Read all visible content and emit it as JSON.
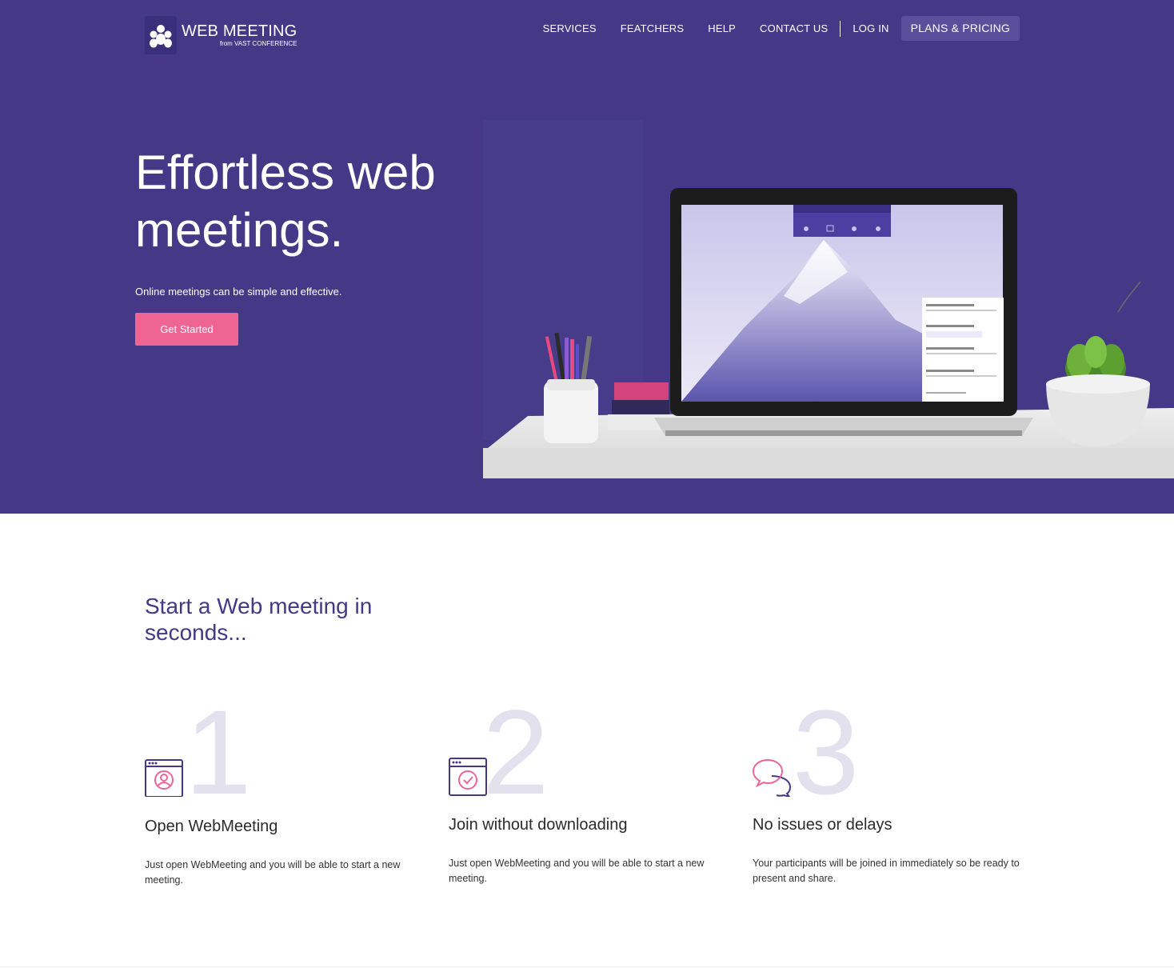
{
  "brand": {
    "title": "WEB MEETING",
    "subtitle": "from VAST CONFERENCE"
  },
  "nav": {
    "items": [
      "SERVICES",
      "FEATCHERS",
      "HELP",
      "CONTACT US"
    ],
    "login": "LOG IN",
    "pricing": "PLANS & PRICING"
  },
  "hero": {
    "title": "Effortless web meetings.",
    "subtitle": "Online meetings can be simple and effective.",
    "cta": "Get Started"
  },
  "steps_section": {
    "heading": "Start a Web meeting in seconds...",
    "steps": [
      {
        "number": "1",
        "icon": "browser-user-icon",
        "title": "Open WebMeeting",
        "text": "Just open WebMeeting and you will be able to start a new meeting."
      },
      {
        "number": "2",
        "icon": "browser-check-icon",
        "title": "Join without downloading",
        "text": "Just open WebMeeting and you will be able to start a new meeting."
      },
      {
        "number": "3",
        "icon": "chat-bubbles-icon",
        "title": "No issues or delays",
        "text": "Your participants will be joined in immediately so be ready to present and share."
      }
    ]
  },
  "colors": {
    "hero_bg": "#443887",
    "accent_pink": "#ee6594",
    "heading_purple": "#443887"
  }
}
